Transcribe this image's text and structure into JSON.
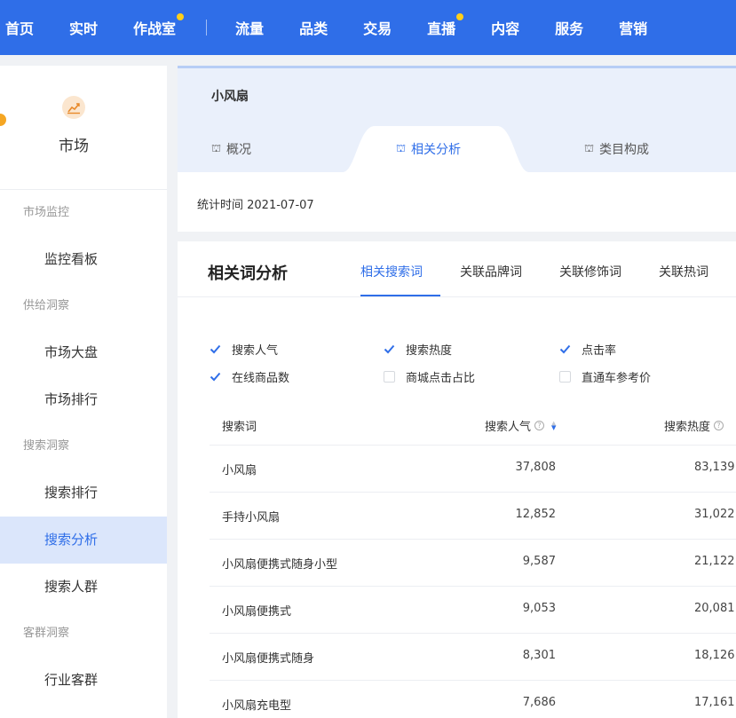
{
  "topnav": {
    "items": [
      {
        "label": "首页",
        "dot": false
      },
      {
        "label": "实时",
        "dot": false
      },
      {
        "label": "作战室",
        "dot": true
      },
      {
        "label": "流量",
        "dot": false
      },
      {
        "label": "品类",
        "dot": false
      },
      {
        "label": "交易",
        "dot": false
      },
      {
        "label": "直播",
        "dot": true
      },
      {
        "label": "内容",
        "dot": false
      },
      {
        "label": "服务",
        "dot": false
      },
      {
        "label": "营销",
        "dot": false
      }
    ]
  },
  "sidebar": {
    "market_label": "市场",
    "groups": [
      {
        "title": "市场监控",
        "items": [
          "监控看板"
        ]
      },
      {
        "title": "供给洞察",
        "items": [
          "市场大盘",
          "市场排行"
        ]
      },
      {
        "title": "搜索洞察",
        "items": [
          "搜索排行",
          "搜索分析",
          "搜索人群"
        ]
      },
      {
        "title": "客群洞察",
        "items": [
          "行业客群"
        ]
      }
    ],
    "active_item": "搜索分析"
  },
  "product": {
    "title": "小风扇",
    "tabs": [
      "概况",
      "相关分析",
      "类目构成"
    ],
    "active_tab": 1,
    "stat_time": "统计时间 2021-07-07"
  },
  "analysis": {
    "title": "相关词分析",
    "sub_tabs": [
      "相关搜索词",
      "关联品牌词",
      "关联修饰词",
      "关联热词"
    ],
    "active_sub_tab": 0,
    "checkboxes": [
      {
        "label": "搜索人气",
        "checked": true
      },
      {
        "label": "搜索热度",
        "checked": true
      },
      {
        "label": "点击率",
        "checked": true
      },
      {
        "label": "在线商品数",
        "checked": true
      },
      {
        "label": "商城点击占比",
        "checked": false
      },
      {
        "label": "直通车参考价",
        "checked": false
      }
    ],
    "table": {
      "headers": [
        "搜索词",
        "搜索人气",
        "搜索热度"
      ],
      "rows": [
        {
          "keyword": "小风扇",
          "popularity": "37,808",
          "heat": "83,139"
        },
        {
          "keyword": "手持小风扇",
          "popularity": "12,852",
          "heat": "31,022"
        },
        {
          "keyword": "小风扇便携式随身小型",
          "popularity": "9,587",
          "heat": "21,122"
        },
        {
          "keyword": "小风扇便携式",
          "popularity": "9,053",
          "heat": "20,081"
        },
        {
          "keyword": "小风扇便携式随身",
          "popularity": "8,301",
          "heat": "18,126"
        },
        {
          "keyword": "小风扇充电型",
          "popularity": "7,686",
          "heat": "17,161"
        }
      ]
    }
  },
  "colors": {
    "brand": "#2f6ee8",
    "nav_dot": "#ffcf1a",
    "active_side_bg": "#dbe6fb"
  }
}
